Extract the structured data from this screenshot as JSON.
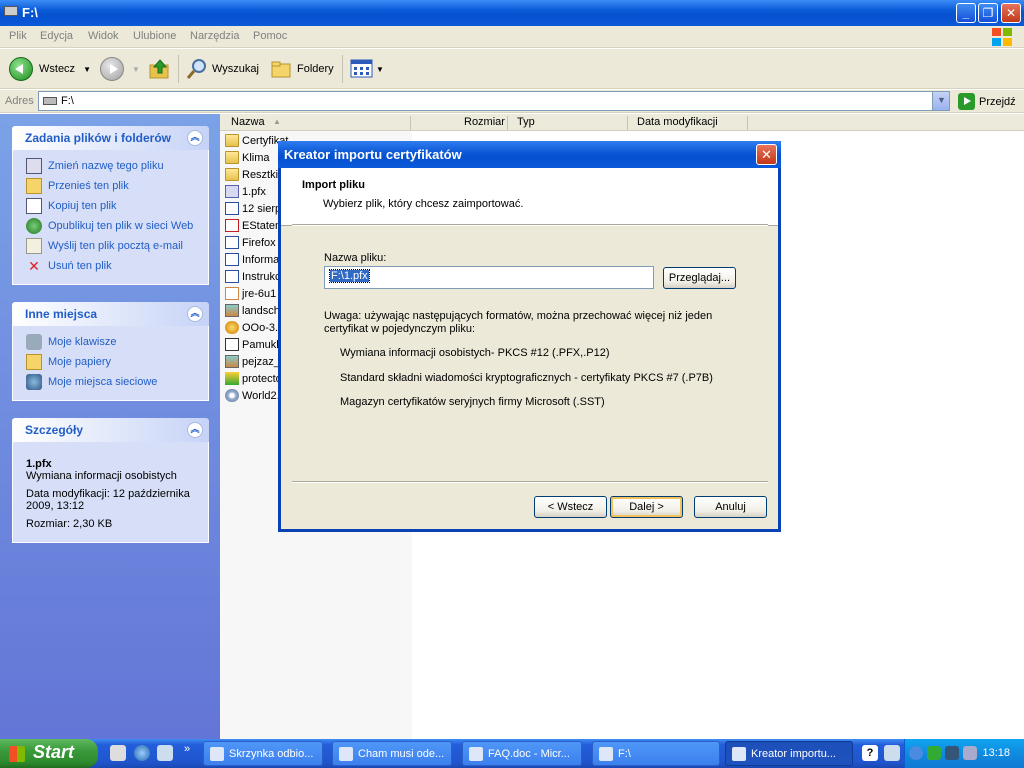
{
  "window": {
    "title": "F:\\"
  },
  "menu": [
    "Plik",
    "Edycja",
    "Widok",
    "Ulubione",
    "Narzędzia",
    "Pomoc"
  ],
  "toolbar": {
    "back": "Wstecz",
    "search": "Wyszukaj",
    "folders": "Foldery"
  },
  "address": {
    "label": "Adres",
    "value": "F:\\",
    "go": "Przejdź"
  },
  "tasks_panel": {
    "title": "Zadania plików i folderów",
    "items": [
      "Zmień nazwę tego pliku",
      "Przenieś ten plik",
      "Kopiuj ten plik",
      "Opublikuj ten plik w sieci Web",
      "Wyślij ten plik pocztą e-mail",
      "Usuń ten plik"
    ]
  },
  "places_panel": {
    "title": "Inne miejsca",
    "items": [
      "Moje klawisze",
      "Moje papiery",
      "Moje miejsca sieciowe"
    ]
  },
  "details_panel": {
    "title": "Szczegóły",
    "name": "1.pfx",
    "type": "Wymiana informacji osobistych",
    "modified": "Data modyfikacji: 12 października 2009, 13:12",
    "size": "Rozmiar: 2,30 KB"
  },
  "list": {
    "headers": {
      "name": "Nazwa",
      "size": "Rozmiar",
      "type": "Typ",
      "date": "Data modyfikacji"
    },
    "files": [
      {
        "name": "Certyfikat",
        "icon": "folder"
      },
      {
        "name": "Klima",
        "icon": "folder"
      },
      {
        "name": "Resztki",
        "icon": "folder"
      },
      {
        "name": "1.pfx",
        "icon": "certificate"
      },
      {
        "name": "12 sierp",
        "icon": "word-doc"
      },
      {
        "name": "EStatem",
        "icon": "pdf"
      },
      {
        "name": "Firefox",
        "icon": "word-doc"
      },
      {
        "name": "Informa",
        "icon": "word-doc"
      },
      {
        "name": "Instrukc",
        "icon": "word-doc"
      },
      {
        "name": "jre-6u1",
        "icon": "java"
      },
      {
        "name": "landsch",
        "icon": "image"
      },
      {
        "name": "OOo-3.",
        "icon": "installer"
      },
      {
        "name": "Pamukk",
        "icon": "shortcut"
      },
      {
        "name": "pejzaz_",
        "icon": "image"
      },
      {
        "name": "protecto",
        "icon": "installer"
      },
      {
        "name": "World2.",
        "icon": "cd"
      }
    ]
  },
  "dialog": {
    "title": "Kreator importu certyfikatów",
    "heading": "Import pliku",
    "subheading": "Wybierz plik, który chcesz zaimportować.",
    "filename_label": "Nazwa pliku:",
    "filename_value": "F:\\1.pfx",
    "browse": "Przeglądaj...",
    "note_line1": "Uwaga: używając następujących formatów, można przechować więcej niż jeden",
    "note_line2": "certyfikat w pojedynczym pliku:",
    "formats": [
      "Wymiana informacji osobistych- PKCS #12 (.PFX,.P12)",
      "Standard składni wiadomości kryptograficznych - certyfikaty PKCS #7 (.P7B)",
      "Magazyn certyfikatów seryjnych firmy Microsoft (.SST)"
    ],
    "back": "< Wstecz",
    "next": "Dalej >",
    "cancel": "Anuluj"
  },
  "taskbar": {
    "start": "Start",
    "buttons": [
      "Skrzynka odbio...",
      "Cham musi ode...",
      "FAQ.doc - Micr...",
      "F:\\",
      "Kreator importu..."
    ],
    "clock": "13:18"
  },
  "colors": {
    "xp_blue": "#0a5ad8",
    "panel_text": "#215dc6",
    "dialog_bg": "#ece9d8"
  }
}
